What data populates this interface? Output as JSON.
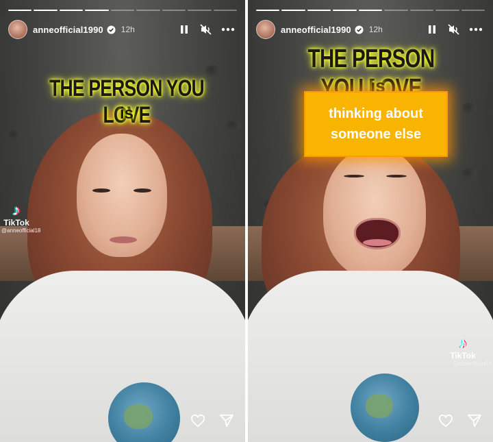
{
  "stories": [
    {
      "username": "anneofficial1990",
      "time": "12h",
      "progress_total": 9,
      "progress_done": 4,
      "headline": "THE PERSON YOU LOVE",
      "headline_is": "is",
      "answer_line1": "",
      "answer_line2": "",
      "tiktok_name": "TikTok",
      "tiktok_handle": "@anneofficial18"
    },
    {
      "username": "anneofficial1990",
      "time": "12h",
      "progress_total": 9,
      "progress_done": 5,
      "headline": "THE PERSON YOU LOVE",
      "headline_is": "is",
      "answer_line1": "thinking about",
      "answer_line2": "someone else",
      "tiktok_name": "TikTok",
      "tiktok_handle": "@anneofficial18"
    }
  ],
  "icons": {
    "pause": "pause-icon",
    "mute": "mute-icon",
    "more": "more-icon",
    "like": "heart-icon",
    "share": "send-icon",
    "verified": "verified-badge-icon"
  },
  "colors": {
    "sticker_glow": "#ffff30",
    "answer_bg": "#f8b400",
    "tiktok_cyan": "#25f4ee",
    "tiktok_red": "#fe2c55"
  }
}
